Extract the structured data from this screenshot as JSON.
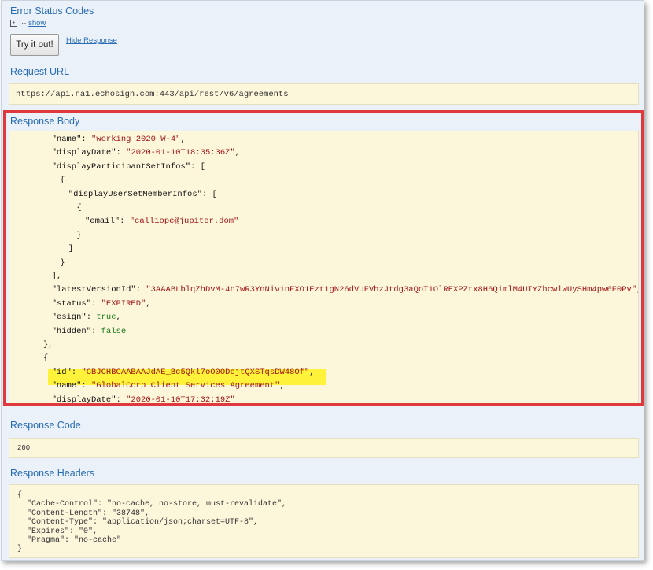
{
  "error_status_codes": {
    "title": "Error Status Codes",
    "show_label": "show"
  },
  "try_button": "Try it out!",
  "hide_response": "Hide Response",
  "request_url": {
    "title": "Request URL",
    "value": "https://api.na1.echosign.com:443/api/rest/v6/agreements"
  },
  "response_body": {
    "title": "Response Body",
    "lines": [
      {
        "indent": 6,
        "parts": [
          {
            "t": "k",
            "v": "\"name\""
          },
          {
            "t": "p",
            "v": ": "
          },
          {
            "t": "s",
            "v": "\"working 2020 W-4\""
          },
          {
            "t": "p",
            "v": ","
          }
        ]
      },
      {
        "indent": 6,
        "parts": [
          {
            "t": "k",
            "v": "\"displayDate\""
          },
          {
            "t": "p",
            "v": ": "
          },
          {
            "t": "s",
            "v": "\"2020-01-10T18:35:36Z\""
          },
          {
            "t": "p",
            "v": ","
          }
        ]
      },
      {
        "indent": 6,
        "parts": [
          {
            "t": "k",
            "v": "\"displayParticipantSetInfos\""
          },
          {
            "t": "p",
            "v": ": ["
          }
        ]
      },
      {
        "indent": 7,
        "parts": [
          {
            "t": "p",
            "v": "{"
          }
        ]
      },
      {
        "indent": 8,
        "parts": [
          {
            "t": "k",
            "v": "\"displayUserSetMemberInfos\""
          },
          {
            "t": "p",
            "v": ": ["
          }
        ]
      },
      {
        "indent": 9,
        "parts": [
          {
            "t": "p",
            "v": "{"
          }
        ]
      },
      {
        "indent": 10,
        "parts": [
          {
            "t": "k",
            "v": "\"email\""
          },
          {
            "t": "p",
            "v": ": "
          },
          {
            "t": "s",
            "v": "\"calliope@jupiter.dom\""
          }
        ]
      },
      {
        "indent": 9,
        "parts": [
          {
            "t": "p",
            "v": "}"
          }
        ]
      },
      {
        "indent": 8,
        "parts": [
          {
            "t": "p",
            "v": "]"
          }
        ]
      },
      {
        "indent": 7,
        "parts": [
          {
            "t": "p",
            "v": "}"
          }
        ]
      },
      {
        "indent": 6,
        "parts": [
          {
            "t": "p",
            "v": "],"
          }
        ]
      },
      {
        "indent": 6,
        "parts": [
          {
            "t": "k",
            "v": "\"latestVersionId\""
          },
          {
            "t": "p",
            "v": ": "
          },
          {
            "t": "s",
            "v": "\"3AAABLblqZhDvM-4n7wR3YnNiv1nFXO1Ezt1gN26dVUFVhzJtdg3aQoT1OlREXPZtx8H6QimlM4UIYZhcwlwUySHm4pw6F0Pv\""
          },
          {
            "t": "p",
            "v": ","
          }
        ]
      },
      {
        "indent": 6,
        "parts": [
          {
            "t": "k",
            "v": "\"status\""
          },
          {
            "t": "p",
            "v": ": "
          },
          {
            "t": "s",
            "v": "\"EXPIRED\""
          },
          {
            "t": "p",
            "v": ","
          }
        ]
      },
      {
        "indent": 6,
        "parts": [
          {
            "t": "k",
            "v": "\"esign\""
          },
          {
            "t": "p",
            "v": ": "
          },
          {
            "t": "b",
            "v": "true"
          },
          {
            "t": "p",
            "v": ","
          }
        ]
      },
      {
        "indent": 6,
        "parts": [
          {
            "t": "k",
            "v": "\"hidden\""
          },
          {
            "t": "p",
            "v": ": "
          },
          {
            "t": "b",
            "v": "false"
          }
        ]
      },
      {
        "indent": 5,
        "parts": [
          {
            "t": "p",
            "v": "},"
          }
        ]
      },
      {
        "indent": 5,
        "parts": [
          {
            "t": "p",
            "v": "{"
          }
        ]
      },
      {
        "indent": 6,
        "parts": [
          {
            "t": "k",
            "v": "\"id\""
          },
          {
            "t": "p",
            "v": ": "
          },
          {
            "t": "s",
            "v": "\"CBJCHBCAABAAJdAE_Bc5Qkl7oO0ODcjtQXSTqsDW48Of\""
          },
          {
            "t": "p",
            "v": ","
          }
        ]
      },
      {
        "indent": 6,
        "parts": [
          {
            "t": "k",
            "v": "\"name\""
          },
          {
            "t": "p",
            "v": ": "
          },
          {
            "t": "s",
            "v": "\"GlobalCorp Client Services Agreement\""
          },
          {
            "t": "p",
            "v": ","
          }
        ]
      },
      {
        "indent": 6,
        "parts": [
          {
            "t": "k",
            "v": "\"displayDate\""
          },
          {
            "t": "p",
            "v": ": "
          },
          {
            "t": "s",
            "v": "\"2020-01-10T17:32:19Z\""
          }
        ]
      }
    ]
  },
  "response_code": {
    "title": "Response Code",
    "value": "200"
  },
  "response_headers": {
    "title": "Response Headers",
    "lines": [
      "{",
      "  \"Cache-Control\": \"no-cache, no-store, must-revalidate\",",
      "  \"Content-Length\": \"38748\",",
      "  \"Content-Type\": \"application/json;charset=UTF-8\",",
      "  \"Expires\": \"0\",",
      "  \"Pragma\": \"no-cache\"",
      "}"
    ]
  },
  "colors": {
    "accent": "#2a6db3",
    "panel": "#eaf1f8",
    "code_bg": "#fcf6db",
    "highlight": "#fff23a",
    "annotation": "#e0393d",
    "string": "#a11616",
    "boolean": "#1a7a1a"
  }
}
